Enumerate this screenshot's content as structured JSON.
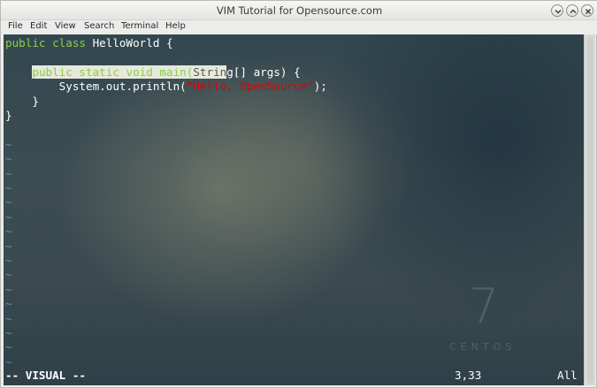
{
  "window": {
    "title": "VIM Tutorial for Opensource.com"
  },
  "menu": [
    "File",
    "Edit",
    "View",
    "Search",
    "Terminal",
    "Help"
  ],
  "code": {
    "l1_kw": "public class ",
    "l1_txt": "HelloWorld {",
    "l3_sel_kw": "public static void main(",
    "l3_sel_t": "Strin",
    "l3_rest": "g[] args) {",
    "l4_txt": "System.out.println(",
    "l4_str": "\"Hello, OpenSource\"",
    "l4_end": ");",
    "l5_txt": "}",
    "l6_txt": "}"
  },
  "tilde": "~",
  "status": {
    "mode": "-- VISUAL --",
    "position": "3,33",
    "scroll": "All"
  },
  "watermark": {
    "number": "7",
    "text": "CENTOS"
  },
  "colors": {
    "keyword": "#8ccd46",
    "string": "#e00000",
    "tilde": "#5b8fb5"
  }
}
